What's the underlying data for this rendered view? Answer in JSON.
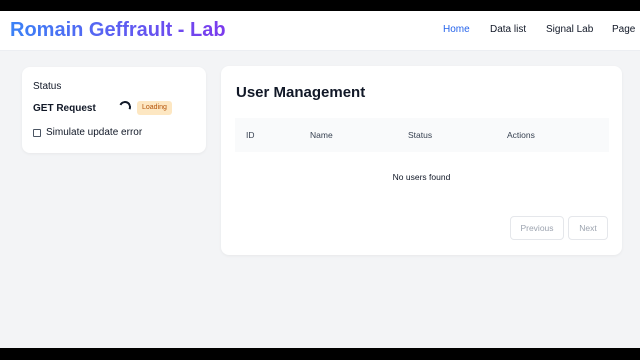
{
  "header": {
    "brand": "Romain Geffrault - Lab",
    "nav": [
      {
        "label": "Home",
        "active": true
      },
      {
        "label": "Data list",
        "active": false
      },
      {
        "label": "Signal Lab",
        "active": false
      },
      {
        "label": "Page",
        "active": false
      }
    ]
  },
  "status_panel": {
    "title": "Status",
    "request_label": "GET Request",
    "badge": "Loading",
    "checkbox_label": "Simulate update error",
    "checkbox_checked": false
  },
  "users": {
    "title": "User Management",
    "columns": [
      "ID",
      "Name",
      "Status",
      "Actions"
    ],
    "empty_message": "No users found",
    "prev_label": "Previous",
    "next_label": "Next"
  },
  "colors": {
    "brand_gradient_start": "#3b82f6",
    "brand_gradient_end": "#7c3aed",
    "active_nav": "#2563eb",
    "badge_bg": "#fde7c2",
    "badge_text": "#b45309"
  },
  "icons": {
    "spinner": "loading-spinner-icon",
    "checkbox": "checkbox-unchecked"
  }
}
